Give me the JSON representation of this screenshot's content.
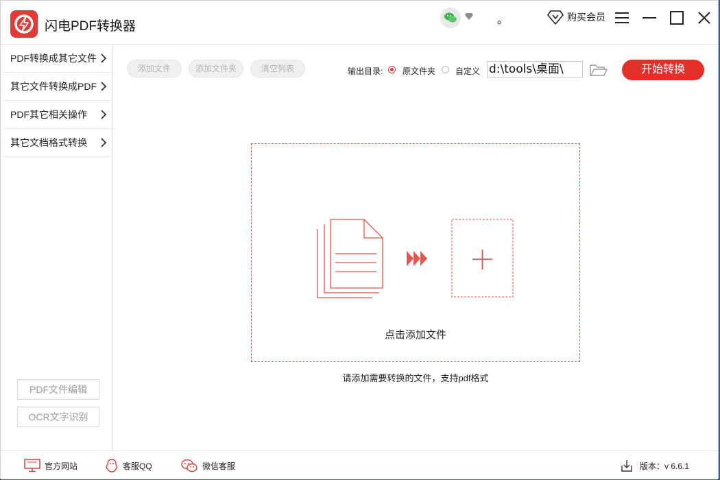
{
  "app": {
    "title": "闪电PDF转换器"
  },
  "titlebar": {
    "dot": "。",
    "vip_label": "购买会员"
  },
  "sidebar": {
    "items": [
      {
        "label": "PDF转换成其它文件"
      },
      {
        "label": "其它文件转换成PDF"
      },
      {
        "label": "PDF其它相关操作"
      },
      {
        "label": "其它文档格式转换"
      }
    ],
    "bottom_buttons": {
      "edit_label": "PDF文件编辑",
      "ocr_label": "OCR文字识别"
    }
  },
  "toolbar": {
    "add_file": "添加文件",
    "add_folder": "添加文件夹",
    "clear_list": "清空列表",
    "output_label": "输出目录:",
    "option_original": "原文件夹",
    "option_custom": "自定义",
    "selected_option": "原文件夹",
    "path_value": "d:\\tools\\桌面\\",
    "start_label": "开始转换"
  },
  "dropzone": {
    "label": "点击添加文件",
    "hint": "请添加需要转换的文件，支持pdf格式"
  },
  "footer": {
    "website": "官方网站",
    "qq": "客服QQ",
    "wechat": "微信客服",
    "version": "版本：v 6.6.1"
  },
  "colors": {
    "accent": "#e32f2a",
    "dash": "#e2574f",
    "desktop": "#2b5d9a"
  },
  "icons": [
    "app-logo-icon",
    "wechat-icon",
    "diamond-icon",
    "menu-icon",
    "minimize-icon",
    "maximize-icon",
    "close-icon",
    "chevron-right-icon",
    "folder-open-icon",
    "document-stack-icon",
    "fast-forward-icon",
    "plus-icon",
    "monitor-icon",
    "qq-icon",
    "wechat-service-icon",
    "download-icon"
  ]
}
